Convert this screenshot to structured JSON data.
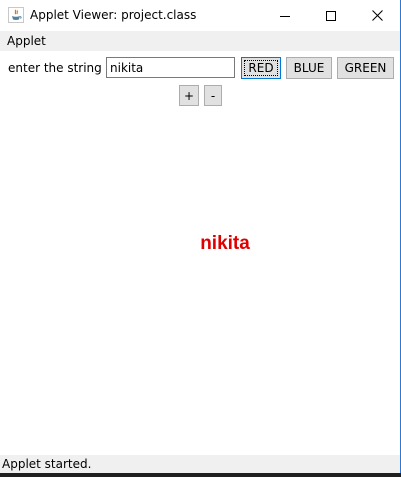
{
  "window": {
    "title": "Applet Viewer: project.class",
    "app_icon": "java-icon",
    "controls": {
      "minimize_icon": "minimize-icon",
      "maximize_icon": "maximize-icon",
      "close_icon": "close-icon"
    }
  },
  "menubar": {
    "items": [
      {
        "label": "Applet"
      }
    ]
  },
  "form": {
    "prompt_label": "enter the string",
    "input_value": "nikita",
    "buttons": {
      "red": "RED",
      "blue": "BLUE",
      "green": "GREEN",
      "increase": "+",
      "decrease": "-"
    }
  },
  "canvas": {
    "display_text": "nikita",
    "display_color": "#e00000"
  },
  "status": {
    "text": "Applet started."
  }
}
